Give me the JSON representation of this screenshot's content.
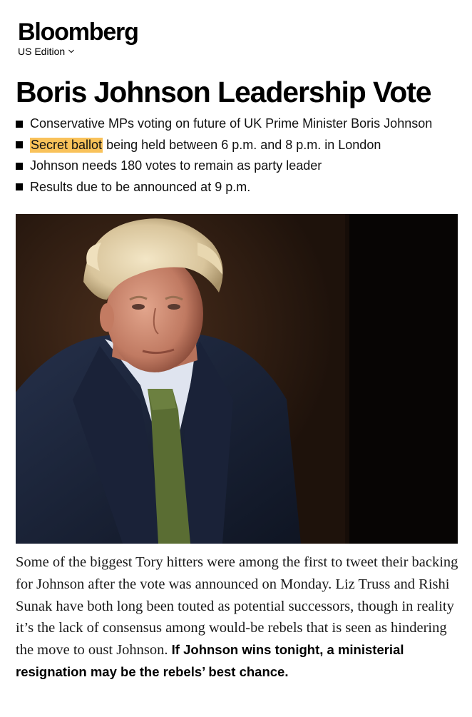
{
  "header": {
    "logo": "Bloomberg",
    "edition": "US Edition"
  },
  "headline": "Boris Johnson Leadership Vote",
  "bullets": [
    {
      "highlight": "",
      "text": "Conservative MPs voting on future of UK Prime Minister Boris Johnson"
    },
    {
      "highlight": "Secret ballot",
      "text": " being held between 6 p.m. and 8 p.m. in London"
    },
    {
      "highlight": "",
      "text": "Johnson needs 180 votes to remain as party leader"
    },
    {
      "highlight": "",
      "text": "Results due to be announced at 9 p.m."
    }
  ],
  "article": {
    "paragraph": "Some of the biggest Tory hitters were among the first to tweet their backing for Johnson after the vote was announced on Monday. Liz Truss and Rishi Sunak have both long been touted as potential successors, though in reality it’s the lack of consensus among would-be rebels that is seen as hindering the move to oust Johnson.",
    "bold": "If Johnson wins tonight, a ministerial resignation may be the rebels’ best chance."
  },
  "colors": {
    "highlight": "#f9c25a",
    "text": "#111111"
  }
}
